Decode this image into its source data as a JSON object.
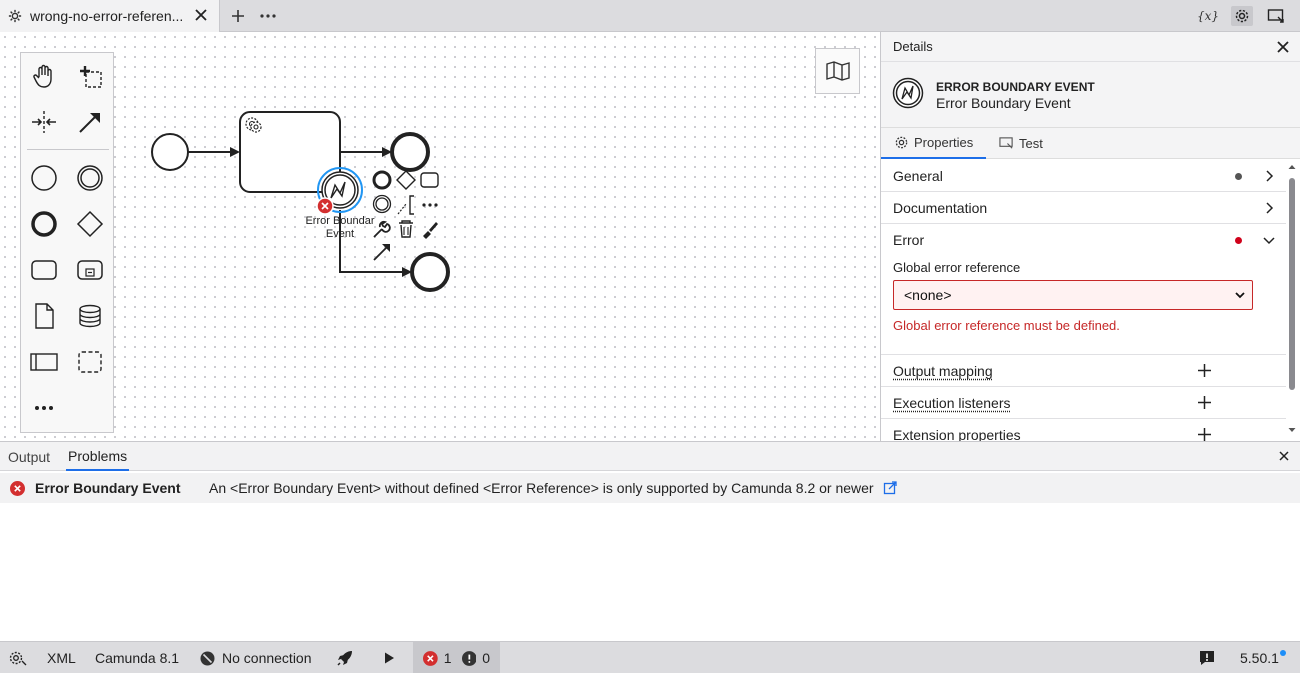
{
  "tabbar": {
    "file_tab_label": "wrong-no-error-referen...",
    "variables_label": "{x}"
  },
  "diagram": {
    "boundary_event_label_line1": "Error Boundar",
    "boundary_event_label_line2": "Event"
  },
  "details": {
    "header_title": "Details",
    "element_type": "ERROR BOUNDARY EVENT",
    "element_name": "Error Boundary Event",
    "tabs": [
      {
        "label": "Properties"
      },
      {
        "label": "Test"
      }
    ],
    "groups": {
      "general": "General",
      "documentation": "Documentation",
      "error": "Error",
      "output_mapping": "Output mapping",
      "execution_listeners": "Execution listeners",
      "extension_properties": "Extension properties"
    },
    "error_field": {
      "label": "Global error reference",
      "value": "<none>",
      "error_message": "Global error reference must be defined."
    },
    "colors": {
      "error": "#c62828",
      "dot_neutral": "#555555",
      "accent": "#1d6ee8"
    }
  },
  "bottom_panel": {
    "tabs": [
      {
        "label": "Output"
      },
      {
        "label": "Problems"
      }
    ],
    "problem": {
      "element": "Error Boundary Event",
      "message": "An <Error Boundary Event> without defined <Error Reference> is only supported by Camunda 8.2 or newer"
    }
  },
  "statusbar": {
    "xml_label": "XML",
    "engine_label": "Camunda 8.1",
    "connection_label": "No connection",
    "errors_count": "1",
    "warnings_count": "0",
    "version": "5.50.1"
  }
}
